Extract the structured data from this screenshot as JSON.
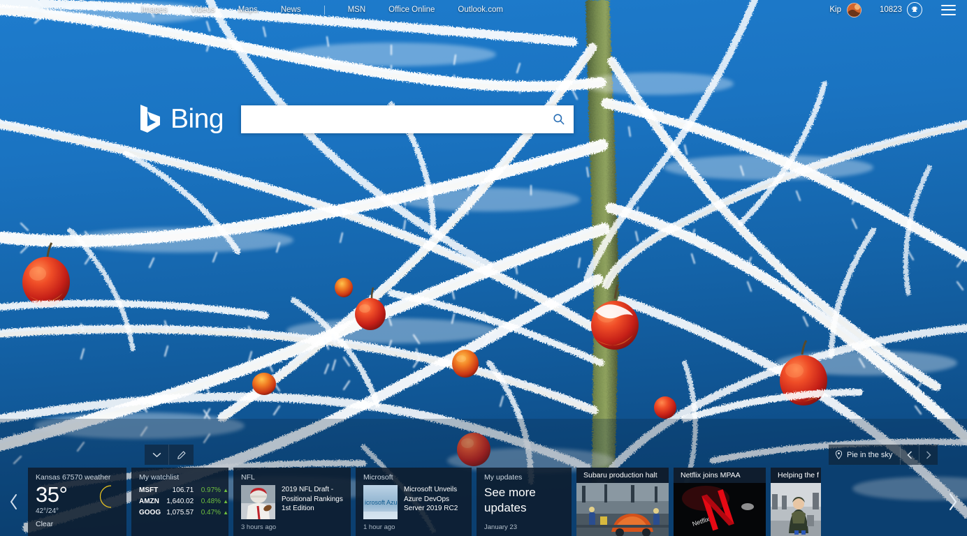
{
  "page": {
    "background_alt": "Frost-covered apple tree branches with red apples against a blue winter sky",
    "sky_color": "#1a74c3",
    "accent_green": "#6fbf3f"
  },
  "topnav": {
    "links": [
      "Images",
      "Videos",
      "Maps",
      "News"
    ],
    "secondary": [
      "MSN",
      "Office Online",
      "Outlook.com"
    ],
    "user_name": "Kip",
    "rewards_points": "10823",
    "rewards_icon": "trophy-icon",
    "menu_icon": "hamburger-icon",
    "avatar_icon": "user-avatar"
  },
  "search": {
    "logo_text": "Bing",
    "value": "",
    "placeholder": "",
    "button_icon": "search-icon"
  },
  "image_caption": {
    "title": "Pie in the sky",
    "pin_icon": "location-pin-icon",
    "prev_icon": "chevron-left-icon",
    "next_icon": "chevron-right-icon"
  },
  "card_toolbar": {
    "collapse_icon": "chevron-down-icon",
    "collapse_label": "Collapse",
    "edit_icon": "pencil-icon",
    "edit_label": "Personalize"
  },
  "strip": {
    "prev_icon": "chevron-left-icon",
    "next_icon": "chevron-right-icon"
  },
  "cards": {
    "weather": {
      "header": "Kansas 67570 weather",
      "temperature": "35°",
      "high_low": "42°/24°",
      "condition": "Clear",
      "icon": "crescent-moon-icon"
    },
    "watchlist": {
      "header": "My watchlist",
      "rows": [
        {
          "symbol": "MSFT",
          "price": "106.71",
          "change": "0.97%",
          "direction": "up"
        },
        {
          "symbol": "AMZN",
          "price": "1,640.02",
          "change": "0.48%",
          "direction": "up"
        },
        {
          "symbol": "GOOG",
          "price": "1,075.57",
          "change": "0.47%",
          "direction": "up"
        }
      ]
    },
    "nfl": {
      "header": "NFL",
      "title": "2019 NFL Draft - Positional Rankings 1st Edition",
      "time": "3 hours ago",
      "thumb_alt": "NFL player in red helmet"
    },
    "microsoft": {
      "header": "Microsoft",
      "title": "Microsoft Unveils Azure DevOps Server 2019 RC2",
      "time": "1 hour ago",
      "thumb_alt": "Microsoft Azure logo banner"
    },
    "updates": {
      "header": "My updates",
      "title": "See more updates",
      "date": "January 23"
    },
    "subaru": {
      "caption": "Subaru production halt",
      "photo_alt": "Car assembly line with orange car body"
    },
    "netflix": {
      "caption": "Netflix joins MPAA",
      "photo_alt": "Red Netflix logo on dark background"
    },
    "helping": {
      "caption": "Helping the f",
      "photo_alt": "People in an airport terminal"
    }
  }
}
